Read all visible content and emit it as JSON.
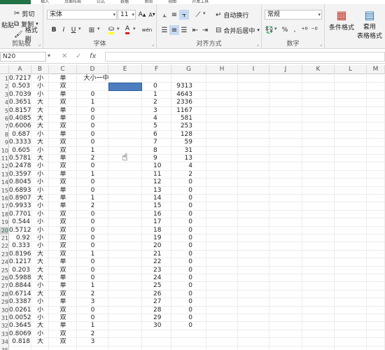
{
  "tabs": [
    "插入",
    "页面布局",
    "公式",
    "数据",
    "审阅",
    "视图",
    "开发工具"
  ],
  "clipboard": {
    "paste_label": "粘贴",
    "cut_label": "剪切",
    "copy_label": "复制",
    "format_painter_label": "格式刷",
    "group_label": "剪贴板"
  },
  "font": {
    "name": "宋体",
    "size": "11",
    "grow_label": "A",
    "shrink_label": "A",
    "bold": "B",
    "italic": "I",
    "underline": "U",
    "font_color_letter": "A",
    "phonetic_label": "wén",
    "group_label": "字体"
  },
  "alignment": {
    "wrap_label": "自动换行",
    "merge_label": "合并后居中",
    "group_label": "对齐方式"
  },
  "number": {
    "format": "常规",
    "percent": "%",
    "comma": ",",
    "group_label": "数字"
  },
  "styles": {
    "conditional_label": "条件格式",
    "table_label_1": "套用",
    "table_label_2": "表格格式"
  },
  "formula_bar": {
    "name_box": "N20",
    "fx": "fx"
  },
  "columns": [
    "A",
    "B",
    "C",
    "D",
    "E",
    "F",
    "G",
    "H",
    "I",
    "J",
    "K",
    "L",
    "M"
  ],
  "row_numbers": [
    "1",
    "2",
    "3",
    "4",
    "5",
    "6",
    "7",
    "8",
    "9",
    "10",
    "11",
    "12",
    "13",
    "14",
    "15",
    "16",
    "17",
    "18",
    "19",
    "20",
    "21",
    "22",
    "23",
    "24",
    "25",
    "26",
    "27",
    "28",
    "29",
    "30",
    "31",
    "32",
    "33",
    "34",
    "35"
  ],
  "selected_row": "20",
  "header_d": "大小一中",
  "rows": [
    {
      "a": "0.7217",
      "b": "小",
      "c": "单",
      "d": "",
      "f": "",
      "g": ""
    },
    {
      "a": "0.503",
      "b": "小",
      "c": "双",
      "d": "",
      "f": "0",
      "g": "9313"
    },
    {
      "a": "0.7039",
      "b": "小",
      "c": "单",
      "d": "0",
      "f": "1",
      "g": "4643"
    },
    {
      "a": "0.3651",
      "b": "大",
      "c": "双",
      "d": "1",
      "f": "2",
      "g": "2336"
    },
    {
      "a": "0.8157",
      "b": "大",
      "c": "单",
      "d": "0",
      "f": "3",
      "g": "1167"
    },
    {
      "a": "0.4085",
      "b": "大",
      "c": "单",
      "d": "0",
      "f": "4",
      "g": "581"
    },
    {
      "a": "0.6006",
      "b": "大",
      "c": "双",
      "d": "0",
      "f": "5",
      "g": "253"
    },
    {
      "a": "0.687",
      "b": "小",
      "c": "单",
      "d": "0",
      "f": "6",
      "g": "128"
    },
    {
      "a": "0.3333",
      "b": "大",
      "c": "双",
      "d": "0",
      "f": "7",
      "g": "59"
    },
    {
      "a": "0.605",
      "b": "小",
      "c": "双",
      "d": "1",
      "f": "8",
      "g": "31"
    },
    {
      "a": "0.5781",
      "b": "大",
      "c": "单",
      "d": "2",
      "f": "9",
      "g": "13"
    },
    {
      "a": "0.2478",
      "b": "小",
      "c": "双",
      "d": "0",
      "f": "10",
      "g": "4"
    },
    {
      "a": "0.3597",
      "b": "小",
      "c": "单",
      "d": "1",
      "f": "11",
      "g": "2"
    },
    {
      "a": "0.8045",
      "b": "小",
      "c": "双",
      "d": "0",
      "f": "12",
      "g": "0"
    },
    {
      "a": "0.6893",
      "b": "小",
      "c": "单",
      "d": "0",
      "f": "13",
      "g": "0"
    },
    {
      "a": "0.8907",
      "b": "大",
      "c": "单",
      "d": "1",
      "f": "14",
      "g": "0"
    },
    {
      "a": "0.9933",
      "b": "小",
      "c": "单",
      "d": "2",
      "f": "15",
      "g": "0"
    },
    {
      "a": "0.7701",
      "b": "小",
      "c": "双",
      "d": "0",
      "f": "16",
      "g": "0"
    },
    {
      "a": "0.544",
      "b": "小",
      "c": "双",
      "d": "0",
      "f": "17",
      "g": "0"
    },
    {
      "a": "0.5712",
      "b": "小",
      "c": "双",
      "d": "0",
      "f": "18",
      "g": "0"
    },
    {
      "a": "0.92",
      "b": "小",
      "c": "双",
      "d": "0",
      "f": "19",
      "g": "0"
    },
    {
      "a": "0.333",
      "b": "小",
      "c": "双",
      "d": "0",
      "f": "20",
      "g": "0"
    },
    {
      "a": "0.8196",
      "b": "大",
      "c": "双",
      "d": "1",
      "f": "21",
      "g": "0"
    },
    {
      "a": "0.1217",
      "b": "大",
      "c": "单",
      "d": "0",
      "f": "22",
      "g": "0"
    },
    {
      "a": "0.203",
      "b": "大",
      "c": "双",
      "d": "0",
      "f": "23",
      "g": "0"
    },
    {
      "a": "0.5988",
      "b": "大",
      "c": "单",
      "d": "0",
      "f": "24",
      "g": "0"
    },
    {
      "a": "0.8844",
      "b": "小",
      "c": "单",
      "d": "1",
      "f": "25",
      "g": "0"
    },
    {
      "a": "0.6714",
      "b": "大",
      "c": "双",
      "d": "2",
      "f": "26",
      "g": "0"
    },
    {
      "a": "0.3387",
      "b": "小",
      "c": "单",
      "d": "3",
      "f": "27",
      "g": "0"
    },
    {
      "a": "0.0261",
      "b": "小",
      "c": "双",
      "d": "0",
      "f": "28",
      "g": "0"
    },
    {
      "a": "0.0052",
      "b": "小",
      "c": "双",
      "d": "0",
      "f": "29",
      "g": "0"
    },
    {
      "a": "0.3645",
      "b": "大",
      "c": "单",
      "d": "1",
      "f": "30",
      "g": "0"
    },
    {
      "a": "0.8069",
      "b": "小",
      "c": "双",
      "d": "2",
      "f": "",
      "g": ""
    },
    {
      "a": "0.818",
      "b": "大",
      "c": "双",
      "d": "3",
      "f": "",
      "g": ""
    },
    {
      "a": "",
      "b": "",
      "c": "",
      "d": "",
      "f": "",
      "g": ""
    }
  ],
  "colors": {
    "accent": "#217346",
    "selection_fill": "#4c7dbf"
  }
}
